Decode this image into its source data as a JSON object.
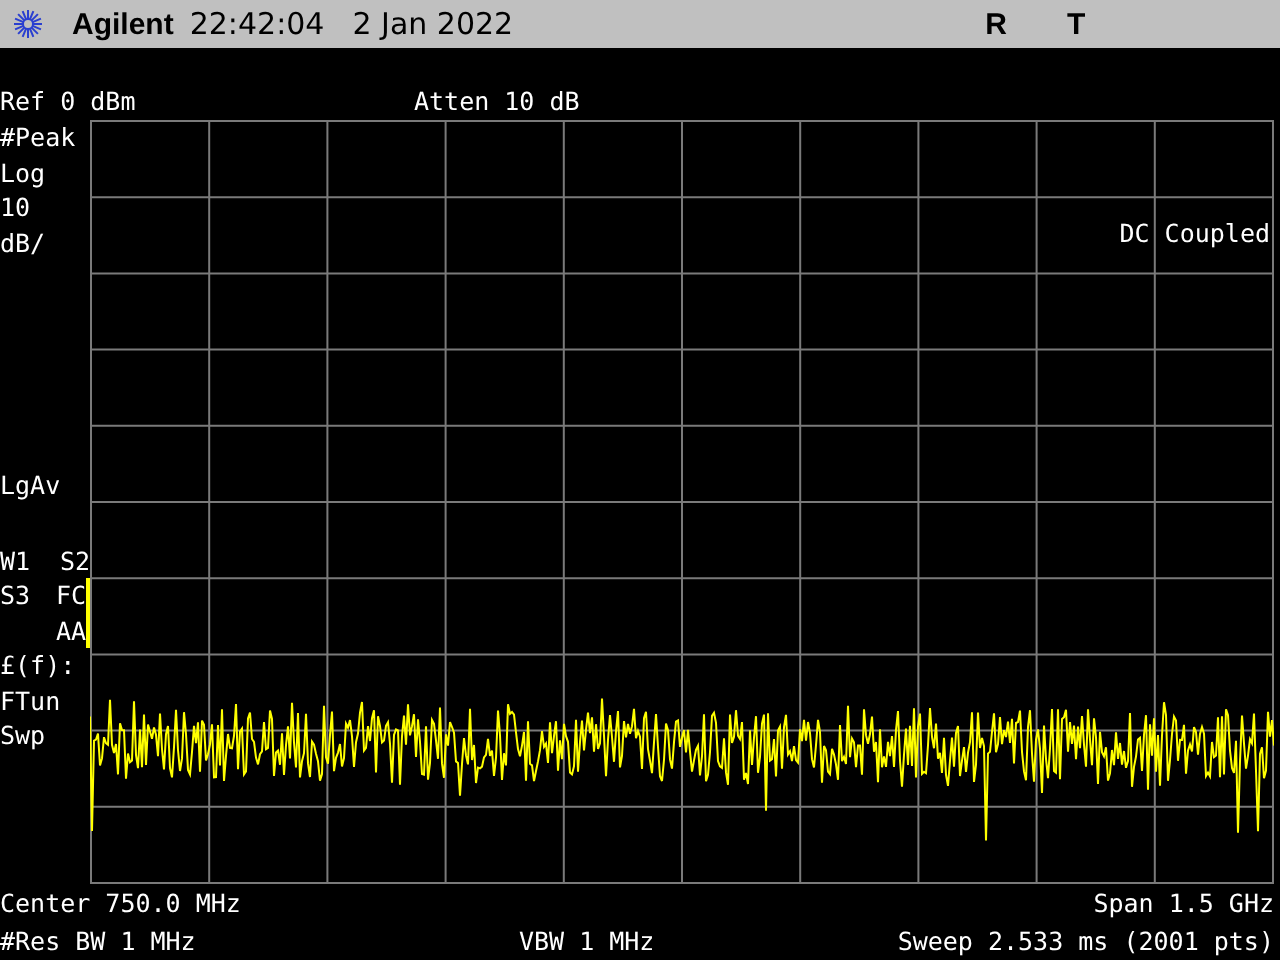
{
  "header": {
    "brand": "Agilent",
    "time": "22:42:04",
    "date": "2 Jan 2022",
    "indicators": [
      "R",
      "T"
    ]
  },
  "ref_level": "Ref 0 dBm",
  "attenuation": "Atten 10 dB",
  "detector": "#Peak",
  "scale": [
    "Log",
    "10",
    "dB/"
  ],
  "average": "LgAv",
  "trace_modes": [
    {
      "left": "W1",
      "right": "S2"
    },
    {
      "left": "S3",
      "right": "FC"
    },
    {
      "right": "AA"
    }
  ],
  "function": "£(f):",
  "tune": "FTun",
  "sweep_mode": "Swp",
  "coupling": "DC Coupled",
  "footer": {
    "center": "Center 750.0 MHz",
    "span": "Span 1.5 GHz",
    "rbw": "#Res BW 1 MHz",
    "vbw": "VBW 1 MHz",
    "sweep": "Sweep 2.533 ms (2001 pts)"
  }
}
